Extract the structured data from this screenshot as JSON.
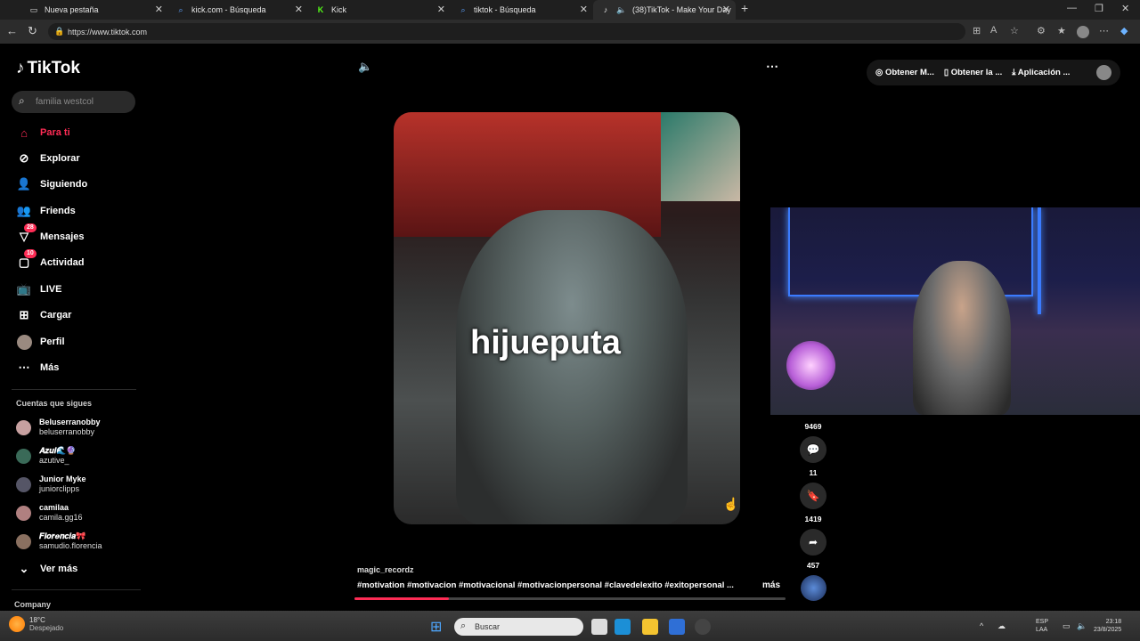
{
  "browser": {
    "tabs": [
      {
        "title": "Nueva pestaña",
        "icon": "page-icon"
      },
      {
        "title": "kick.com - Búsqueda",
        "icon": "search-icon"
      },
      {
        "title": "Kick",
        "icon": "kick-icon"
      },
      {
        "title": "tiktok - Búsqueda",
        "icon": "search-icon"
      },
      {
        "title": "(38)TikTok - Make Your Day",
        "icon": "tiktok-icon"
      }
    ],
    "url": "https://www.tiktok.com"
  },
  "sidebar": {
    "logo": "TikTok",
    "search_placeholder": "familia westcol",
    "nav": [
      {
        "label": "Para ti",
        "icon": "home-icon",
        "active": true
      },
      {
        "label": "Explorar",
        "icon": "compass-icon"
      },
      {
        "label": "Siguiendo",
        "icon": "following-icon"
      },
      {
        "label": "Friends",
        "icon": "friends-icon"
      },
      {
        "label": "Mensajes",
        "icon": "messages-icon",
        "badge": "28"
      },
      {
        "label": "Actividad",
        "icon": "activity-icon",
        "badge": "10"
      },
      {
        "label": "LIVE",
        "icon": "live-icon"
      },
      {
        "label": "Cargar",
        "icon": "upload-icon"
      },
      {
        "label": "Perfil",
        "icon": "profile-avatar"
      },
      {
        "label": "Más",
        "icon": "more-dots-icon"
      }
    ],
    "following_title": "Cuentas que sigues",
    "following": [
      {
        "name": "Beluserranobby",
        "handle": "beluserranobby"
      },
      {
        "name": "𝑨𝒛𝒖𝒍🌊🔮",
        "handle": "azutive_"
      },
      {
        "name": "Junior Myke",
        "handle": "juniorclipps"
      },
      {
        "name": "camilaa",
        "handle": "camila.gg16"
      },
      {
        "name": "𝑭𝒍𝒐𝒓𝒆𝒏𝒄𝒊𝒂🎀",
        "handle": "samudio.florencia"
      }
    ],
    "see_more": "Ver más",
    "company": "Company"
  },
  "header": {
    "items": [
      "Obtener M...",
      "Obtener la ...",
      "Aplicación ..."
    ]
  },
  "video": {
    "overlay_text": "hijueputa",
    "author": "magic_recordz",
    "hashtags": "#motivation  #motivacion  #motivacional  #motivacionpersonal  #clavedelexito  #exitopersonal  ...",
    "more_label": "más",
    "progress_fraction": 0.22
  },
  "actions": {
    "likes": "9469",
    "comments": "11",
    "saves": "1419",
    "shares": "457"
  },
  "taskbar": {
    "search_placeholder": "Buscar",
    "weather_temp": "18°C",
    "weather_desc": "Despejado",
    "lang_top": "ESP",
    "lang_bottom": "LAA",
    "time": "23:18",
    "date": "23/8/2025"
  }
}
